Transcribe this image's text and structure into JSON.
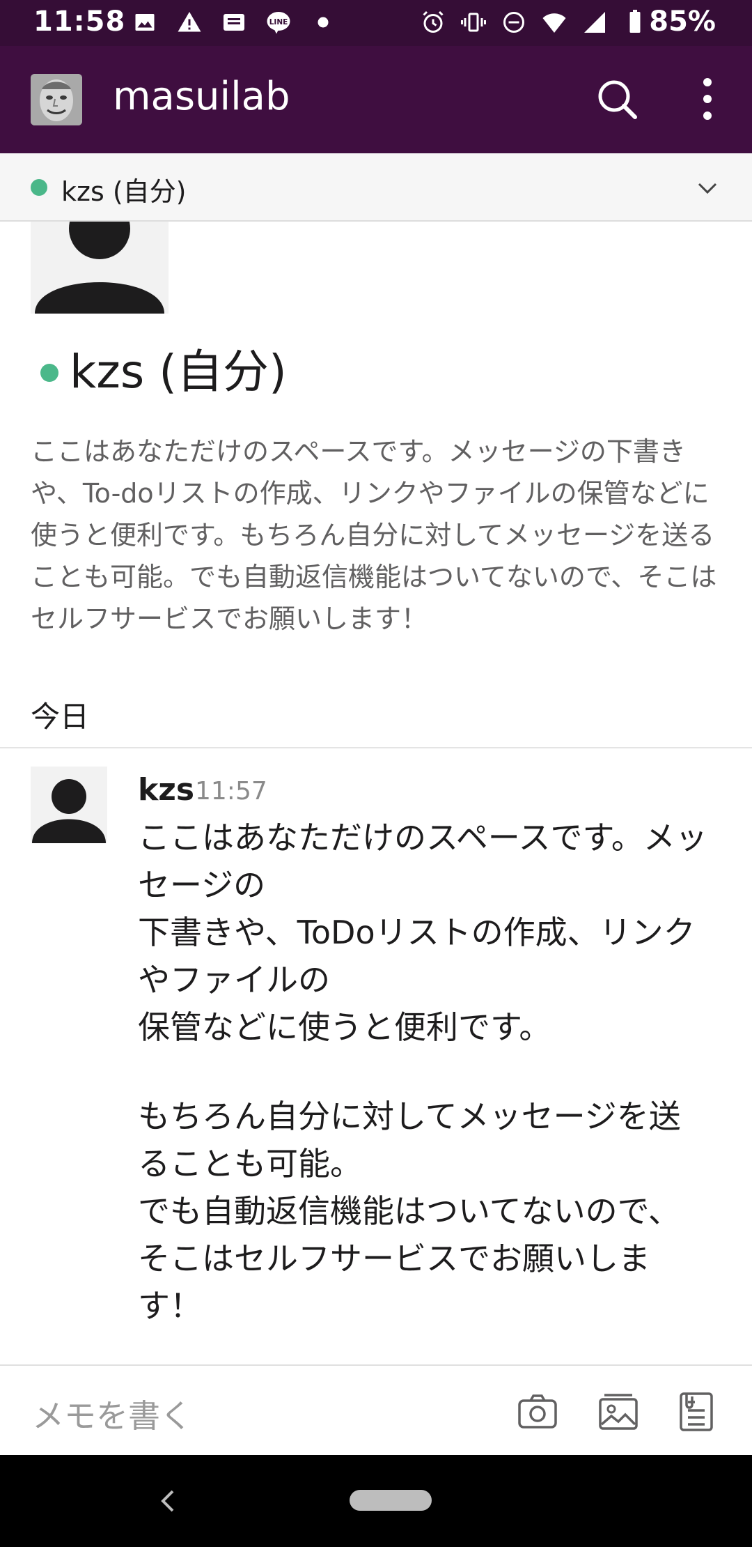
{
  "status_bar": {
    "time": "11:58",
    "left_icons": [
      "image-icon",
      "warning-icon",
      "message-icon",
      "line-app-icon",
      "dot-icon"
    ],
    "right_icons": [
      "alarm-icon",
      "vibrate-icon",
      "dnd-icon",
      "wifi-icon",
      "signal-icon",
      "battery-icon"
    ],
    "battery": "85%"
  },
  "app_bar": {
    "workspace_title": "masuilab",
    "accent_color": "#3f0e40"
  },
  "channel_header": {
    "name": "kzs (自分)",
    "presence_color": "#2bac76"
  },
  "profile": {
    "name": "kzs (自分)",
    "intro": "ここはあなただけのスペースです。メッセージの下書きや、To-doリストの作成、リンクやファイルの保管などに使うと便利です。もちろん自分に対してメッセージを送ることも可能。でも自動返信機能はついてないので、そこはセルフサービスでお願いします！"
  },
  "day_label": "今日",
  "message": {
    "author": "kzs",
    "time": "11:57",
    "lines": [
      "ここはあなただけのスペースです。メッ",
      "セージの",
      "下書きや、ToDoリストの作成、リンク",
      "やファイルの",
      "保管などに使うと便利です。",
      "もちろん自分に対してメッセージを送",
      "ることも可能。",
      "でも自動返信機能はついてないので、",
      "そこはセルフサービスでお願いしま",
      "す！"
    ]
  },
  "composer": {
    "placeholder": "メモを書く"
  }
}
